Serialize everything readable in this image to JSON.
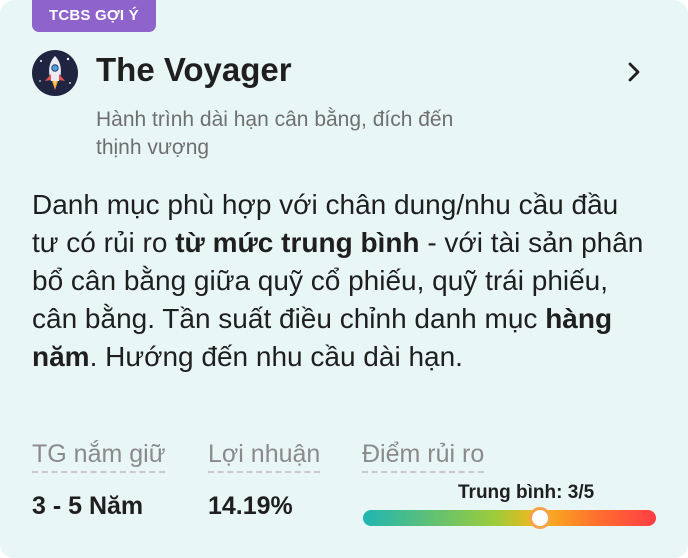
{
  "badge": "TCBS GỢI Ý",
  "portfolio": {
    "title": "The Voyager",
    "icon": "rocket-icon",
    "subtitle": "Hành trình dài hạn cân bằng, đích đến thịnh vượng"
  },
  "description": {
    "part1": "Danh mục phù hợp với chân dung/nhu cầu đầu tư có rủi ro ",
    "bold1": "từ mức trung bình",
    "part2": " - với tài sản phân bổ cân bằng giữa quỹ cổ phiếu, quỹ trái phiếu, cân bằng. Tần suất điều chỉnh danh mục ",
    "bold2": "hàng năm",
    "part3": ". Hướng đến nhu cầu dài hạn."
  },
  "stats": {
    "holding_label": "TG nắm giữ",
    "holding_value": "3 - 5 Năm",
    "return_label": "Lợi nhuận",
    "return_value": "14.19%",
    "risk_label": "Điểm rủi ro",
    "risk_text": "Trung bình: 3/5",
    "risk_score": 3,
    "risk_max": 5,
    "risk_marker_fraction": 0.6
  },
  "colors": {
    "badge": "#8e63cc",
    "card_background": "#e9f6f6",
    "text_primary": "#1f1f1f",
    "text_secondary": "#6f6f6f"
  }
}
